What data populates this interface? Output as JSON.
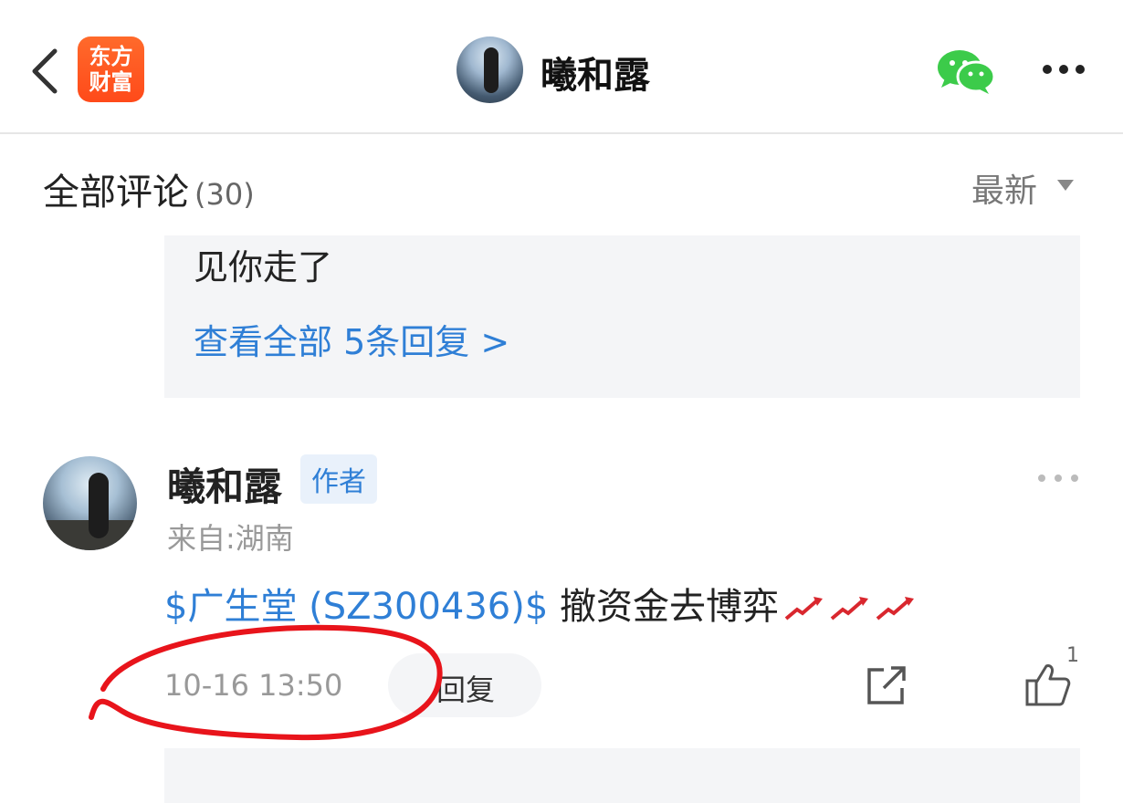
{
  "header": {
    "logo_line1": "东方",
    "logo_line2": "财富",
    "user_name": "曦和露"
  },
  "comments_section": {
    "title": "全部评论",
    "count": "(30)",
    "sort_label": "最新"
  },
  "reply_preview": {
    "text": "见你走了",
    "view_all": "查看全部 5条回复 >"
  },
  "comment": {
    "name": "曦和露",
    "badge": "作者",
    "location": "来自:湖南",
    "stock": "$广生堂 (SZ300436)$",
    "text": " 撤资金去博弈",
    "time": "10-16 13:50",
    "reply_label": "回复",
    "like_count": "1"
  },
  "colors": {
    "accent_blue": "#2f7fd6",
    "logo_orange": "#ff5a22",
    "annotation_red": "#e8141b",
    "wechat_green": "#3ccb4a"
  }
}
